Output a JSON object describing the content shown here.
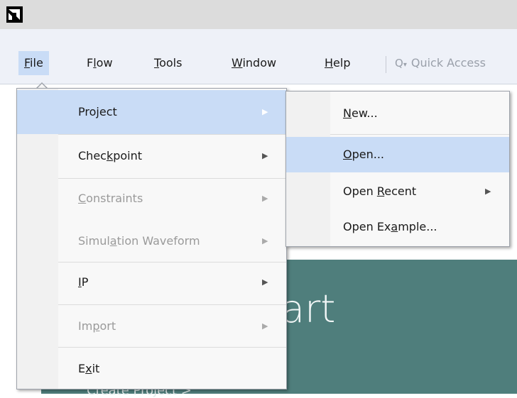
{
  "menubar": {
    "items": [
      {
        "id": "file",
        "pre": "",
        "u": "F",
        "post": "ile"
      },
      {
        "id": "flow",
        "pre": "F",
        "u": "l",
        "post": "ow"
      },
      {
        "id": "tools",
        "pre": "",
        "u": "T",
        "post": "ools"
      },
      {
        "id": "window",
        "pre": "",
        "u": "W",
        "post": "indow"
      },
      {
        "id": "help",
        "pre": "",
        "u": "H",
        "post": "elp"
      }
    ],
    "quick_access": "Quick Access"
  },
  "file_menu": {
    "items": [
      {
        "pre": "Pro",
        "u": "j",
        "post": "ect"
      },
      {
        "pre": "Chec",
        "u": "k",
        "post": "point"
      },
      {
        "pre": "",
        "u": "C",
        "post": "onstraints"
      },
      {
        "pre": "Simul",
        "u": "a",
        "post": "tion Waveform"
      },
      {
        "pre": "",
        "u": "I",
        "post": "P"
      },
      {
        "pre": "Im",
        "u": "p",
        "post": "ort"
      },
      {
        "pre": "E",
        "u": "x",
        "post": "it"
      }
    ]
  },
  "project_submenu": {
    "items": [
      {
        "pre": "",
        "u": "N",
        "post": "ew..."
      },
      {
        "pre": "",
        "u": "O",
        "post": "pen..."
      },
      {
        "pre": "Open ",
        "u": "R",
        "post": "ecent"
      },
      {
        "pre": "Open Ex",
        "u": "a",
        "post": "mple..."
      }
    ]
  },
  "welcome": {
    "heading_fragment": "art",
    "sub_fragment": "Create Project  >"
  },
  "colors": {
    "menubar_bg": "#eef1f8",
    "highlight": "#c9dcf6",
    "welcome_bg": "#4f7e7c",
    "disabled_text": "#9a9a9a"
  }
}
